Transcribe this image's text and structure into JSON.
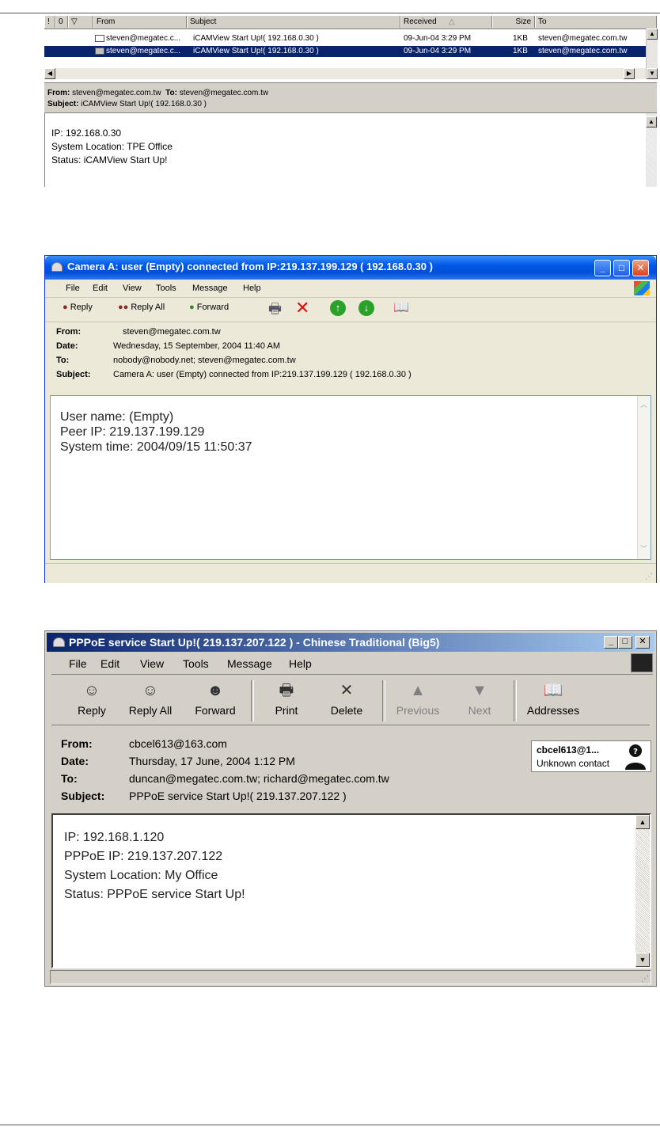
{
  "list_view": {
    "columns": {
      "importance": "!",
      "attachment": "0",
      "flag": "▽",
      "from": "From",
      "subject": "Subject",
      "received": "Received",
      "size": "Size",
      "to": "To"
    },
    "rows": [
      {
        "from": "steven@megatec.c...",
        "subject": "iCAMView Start Up!( 192.168.0.30 )",
        "received": "09-Jun-04 3:29 PM",
        "size": "1KB",
        "to": "steven@megatec.com.tw"
      },
      {
        "from": "steven@megatec.c...",
        "subject": "iCAMView Start Up!( 192.168.0.30 )",
        "received": "09-Jun-04 3:29 PM",
        "size": "1KB",
        "to": "steven@megatec.com.tw"
      }
    ],
    "preview": {
      "from_label": "From:",
      "from_value": "steven@megatec.com.tw",
      "to_label": "To:",
      "to_value": "steven@megatec.com.tw",
      "subject_label": "Subject:",
      "subject_value": "iCAMView Start Up!( 192.168.0.30 )",
      "body": [
        "IP: 192.168.0.30",
        "System Location: TPE Office",
        "Status: iCAMView Start Up!"
      ]
    }
  },
  "window_a": {
    "title": "Camera A: user (Empty) connected from IP:219.137.199.129 ( 192.168.0.30 )",
    "menu": [
      "File",
      "Edit",
      "View",
      "Tools",
      "Message",
      "Help"
    ],
    "toolbar": {
      "reply": "Reply",
      "reply_all": "Reply All",
      "forward": "Forward"
    },
    "header": {
      "from_label": "From:",
      "from_value": "steven@megatec.com.tw",
      "date_label": "Date:",
      "date_value": "Wednesday, 15 September, 2004 11:40 AM",
      "to_label": "To:",
      "to_value": "nobody@nobody.net; steven@megatec.com.tw",
      "subject_label": "Subject:",
      "subject_value": "Camera A: user (Empty) connected from IP:219.137.199.129 ( 192.168.0.30 )"
    },
    "body": [
      "User name: (Empty)",
      "Peer IP: 219.137.199.129",
      "System time: 2004/09/15 11:50:37"
    ]
  },
  "window_b": {
    "title": "PPPoE service Start Up!( 219.137.207.122 ) - Chinese Traditional (Big5)",
    "menu": [
      "File",
      "Edit",
      "View",
      "Tools",
      "Message",
      "Help"
    ],
    "toolbar": {
      "reply": "Reply",
      "reply_all": "Reply All",
      "forward": "Forward",
      "print": "Print",
      "delete": "Delete",
      "previous": "Previous",
      "next": "Next",
      "addresses": "Addresses"
    },
    "header": {
      "from_label": "From:",
      "from_value": "cbcel613@163.com",
      "date_label": "Date:",
      "date_value": "Thursday, 17 June, 2004 1:12 PM",
      "to_label": "To:",
      "to_value": "duncan@megatec.com.tw; richard@megatec.com.tw",
      "subject_label": "Subject:",
      "subject_value": "PPPoE service Start Up!( 219.137.207.122 )"
    },
    "contact": {
      "name": "cbcel613@1...",
      "status": "Unknown contact"
    },
    "body": [
      "IP: 192.168.1.120",
      "PPPoE IP: 219.137.207.122",
      "System Location: My Office",
      "Status: PPPoE service Start Up!"
    ]
  }
}
